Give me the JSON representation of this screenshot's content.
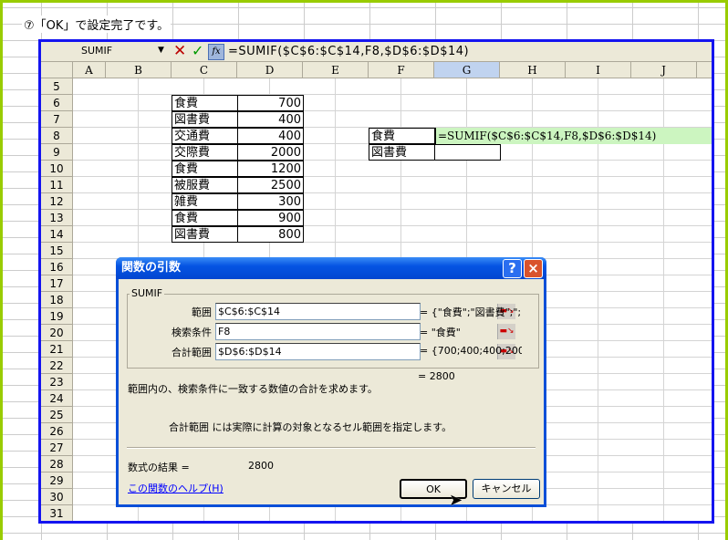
{
  "caption": "⑦「OK」で設定完了です。",
  "formula_bar": {
    "name_box": "SUMIF",
    "formula": "=SUMIF($C$6:$C$14,F8,$D$6:$D$14)",
    "cancel_icon": "x-icon",
    "enter_icon": "check-icon",
    "fx_label": "fx"
  },
  "columns": [
    "A",
    "B",
    "C",
    "D",
    "E",
    "F",
    "G",
    "H",
    "I",
    "J"
  ],
  "selected_column": "G",
  "rows": [
    "5",
    "6",
    "7",
    "8",
    "9",
    "10",
    "11",
    "12",
    "13",
    "14",
    "15",
    "16",
    "17",
    "18",
    "19",
    "20",
    "21",
    "22",
    "23",
    "24",
    "25",
    "26",
    "27",
    "28",
    "29",
    "30",
    "31"
  ],
  "table": [
    {
      "item": "食費",
      "amount": "700"
    },
    {
      "item": "図書費",
      "amount": "400"
    },
    {
      "item": "交通費",
      "amount": "400"
    },
    {
      "item": "交際費",
      "amount": "2000"
    },
    {
      "item": "食費",
      "amount": "1200"
    },
    {
      "item": "被服費",
      "amount": "2500"
    },
    {
      "item": "雑費",
      "amount": "300"
    },
    {
      "item": "食費",
      "amount": "900"
    },
    {
      "item": "図書費",
      "amount": "800"
    }
  ],
  "criteria": {
    "f8": "食費",
    "f9": "図書費"
  },
  "editing_cell": "=SUMIF($C$6:$C$14,F8,$D$6:$D$14)",
  "dialog": {
    "title": "関数の引数",
    "help_icon": "?",
    "close_icon": "×",
    "function": "SUMIF",
    "args": [
      {
        "label": "範囲",
        "value": "$C$6:$C$14",
        "result": "= {\"食費\";\"図書費\";\";"
      },
      {
        "label": "検索条件",
        "value": "F8",
        "result": "= \"食費\""
      },
      {
        "label": "合計範囲",
        "value": "$D$6:$D$14",
        "result": "= {700;400;400;2000;12"
      }
    ],
    "total": "= 2800",
    "description": "範囲内の、検索条件に一致する数値の合計を求めます。",
    "arg_description": "合計範囲 には実際に計算の対象となるセル範囲を指定します。",
    "result_label": "数式の結果 =",
    "result_value": "2800",
    "help_link": "この関数のヘルプ(H)",
    "ok": "OK",
    "cancel": "キャンセル"
  }
}
